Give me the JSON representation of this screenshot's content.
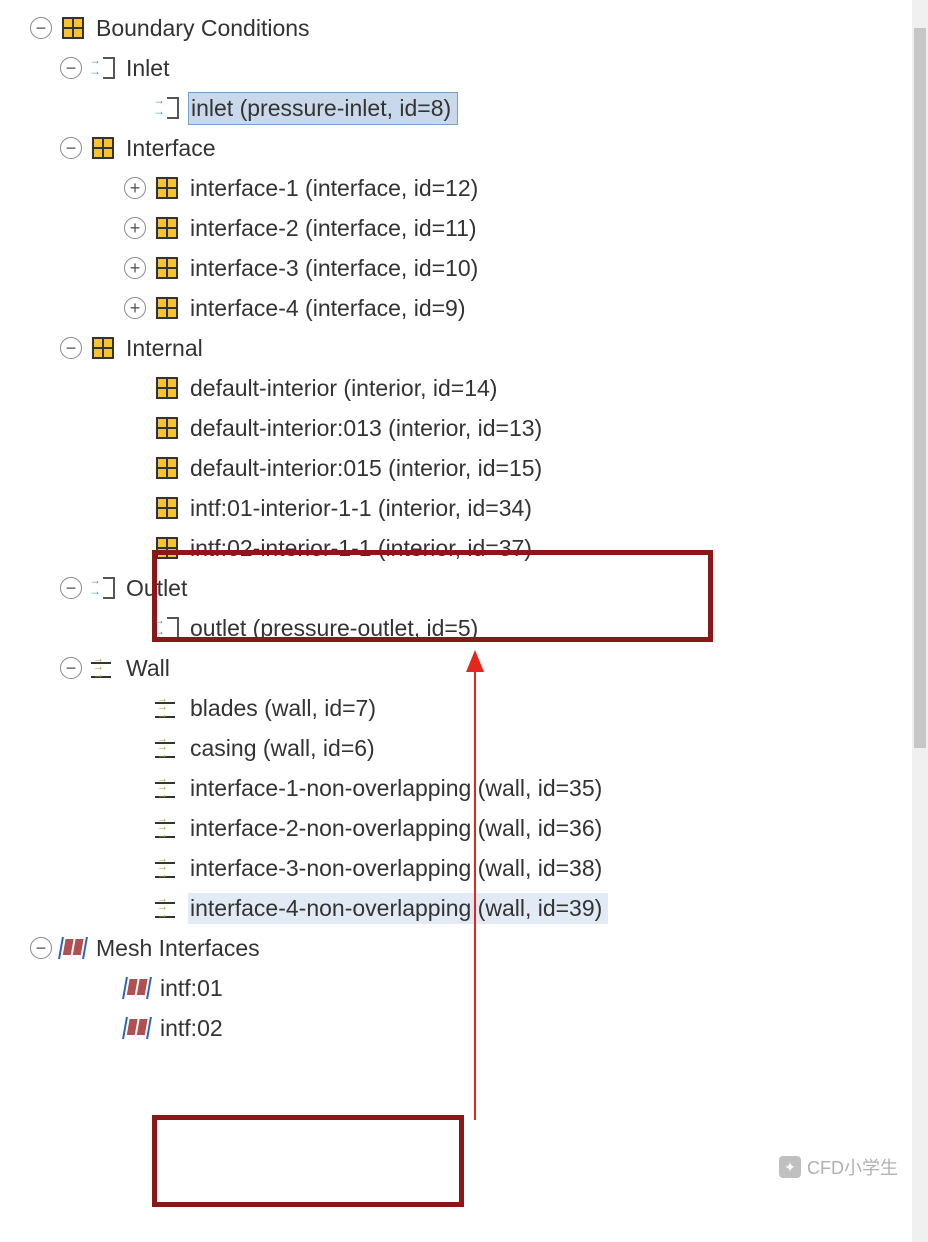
{
  "tree": {
    "boundary_conditions": {
      "label": "Boundary Conditions",
      "inlet": {
        "label": "Inlet",
        "item": "inlet (pressure-inlet, id=8)"
      },
      "interface": {
        "label": "Interface",
        "items": [
          "interface-1 (interface, id=12)",
          "interface-2 (interface, id=11)",
          "interface-3 (interface, id=10)",
          "interface-4 (interface, id=9)"
        ]
      },
      "internal": {
        "label": "Internal",
        "items": [
          "default-interior (interior, id=14)",
          "default-interior:013 (interior, id=13)",
          "default-interior:015 (interior, id=15)",
          "intf:01-interior-1-1 (interior, id=34)",
          "intf:02-interior-1-1 (interior, id=37)"
        ]
      },
      "outlet": {
        "label": "Outlet",
        "item": "outlet (pressure-outlet, id=5)"
      },
      "wall": {
        "label": "Wall",
        "items": [
          "blades (wall, id=7)",
          "casing (wall, id=6)",
          "interface-1-non-overlapping (wall, id=35)",
          "interface-2-non-overlapping (wall, id=36)",
          "interface-3-non-overlapping (wall, id=38)",
          "interface-4-non-overlapping (wall, id=39)"
        ]
      }
    },
    "mesh_interfaces": {
      "label": "Mesh Interfaces",
      "items": [
        "intf:01",
        "intf:02"
      ]
    }
  },
  "watermark": "CFD小学生"
}
